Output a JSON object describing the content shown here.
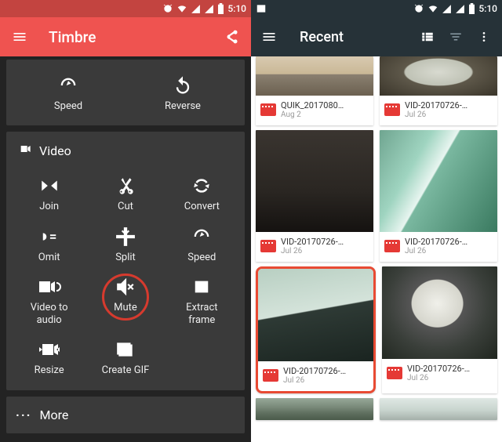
{
  "status": {
    "time": "5:10"
  },
  "left": {
    "app_title": "Timbre",
    "top_actions": [
      {
        "label": "Speed"
      },
      {
        "label": "Reverse"
      }
    ],
    "video_header": "Video",
    "video_actions": [
      {
        "label": "Join"
      },
      {
        "label": "Cut"
      },
      {
        "label": "Convert"
      },
      {
        "label": "Omit"
      },
      {
        "label": "Split"
      },
      {
        "label": "Speed"
      },
      {
        "label": "Video to\naudio"
      },
      {
        "label": "Mute",
        "highlighted": true
      },
      {
        "label": "Extract\nframe"
      },
      {
        "label": "Resize"
      },
      {
        "label": "Create GIF"
      }
    ],
    "more_label": "More"
  },
  "right": {
    "app_title": "Recent",
    "items": [
      {
        "name": "QUIK_2017080…",
        "date": "Aug 2",
        "thumb_class": "t-angel",
        "thumb_h": "thumb-half",
        "show_thumb": true
      },
      {
        "name": "VID-20170726-…",
        "date": "Jul 26",
        "thumb_class": "t-journey",
        "thumb_h": "thumb-half",
        "show_thumb": true
      },
      {
        "name": "VID-20170726-…",
        "date": "Jul 26",
        "thumb_class": "t-dark",
        "thumb_h": "thumb-tall",
        "show_thumb": true
      },
      {
        "name": "VID-20170726-…",
        "date": "Jul 26",
        "thumb_class": "t-falls",
        "thumb_h": "thumb-tall",
        "show_thumb": true
      },
      {
        "name": "VID-20170726-…",
        "date": "Jul 26",
        "thumb_class": "t-mist",
        "thumb_h": "thumb-tall2",
        "show_thumb": true,
        "selected": true
      },
      {
        "name": "VID-20170726-…",
        "date": "Jul 26",
        "thumb_class": "t-tunnel",
        "thumb_h": "thumb-tall2",
        "show_thumb": true
      },
      {
        "name": "",
        "date": "",
        "thumb_class": "t-boat",
        "thumb_h": "thumb-short",
        "show_thumb": true,
        "no_meta": true
      },
      {
        "name": "",
        "date": "",
        "thumb_class": "t-edge",
        "thumb_h": "thumb-short",
        "show_thumb": true,
        "no_meta": true
      }
    ]
  }
}
